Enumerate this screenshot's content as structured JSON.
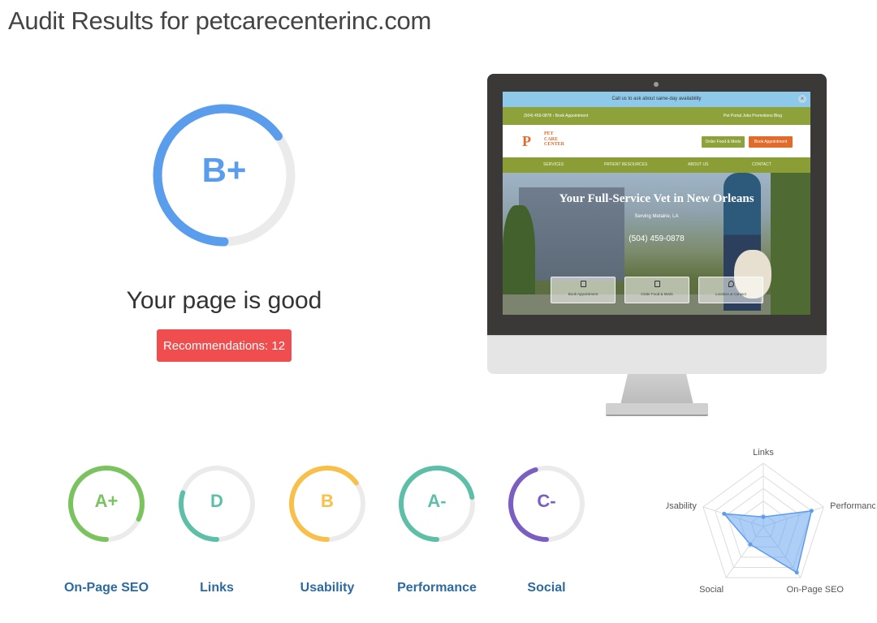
{
  "header": {
    "title": "Audit Results for petcarecenterinc.com"
  },
  "overall": {
    "grade": "B+",
    "progress": 0.65,
    "color": "#5b9ded",
    "summary": "Your page is good",
    "recommendations_label": "Recommendations: 12"
  },
  "preview": {
    "announcement": "Call us to ask about same-day availability",
    "utility_left": "(504) 459-0878   ›  Book Appointment",
    "utility_right": "Pet Portal    Jobs    Promotions    Blog",
    "logo_mark": "P",
    "logo_text": "PET\nCARE\nCENTER",
    "order_button": "Order Food & Meds",
    "book_button": "Book Appointment",
    "nav": [
      "SERVICES",
      "PATIENT RESOURCES",
      "ABOUT US",
      "CONTACT"
    ],
    "hero_title": "Your Full-Service Vet in New Orleans",
    "hero_sub": "Serving Metairie, LA",
    "hero_phone": "(504) 459-0878",
    "cards": [
      "Book Appointment",
      "Order Food & Meds",
      "Location & Contact"
    ]
  },
  "categories": [
    {
      "name": "On-Page SEO",
      "grade": "A+",
      "progress": 0.82,
      "color": "#7ac35e"
    },
    {
      "name": "Links",
      "grade": "D",
      "progress": 0.3,
      "color": "#5dbfa8"
    },
    {
      "name": "Usability",
      "grade": "B",
      "progress": 0.65,
      "color": "#f8c04a"
    },
    {
      "name": "Performance",
      "grade": "A-",
      "progress": 0.72,
      "color": "#5dbfa8"
    },
    {
      "name": "Social",
      "grade": "C-",
      "progress": 0.45,
      "color": "#7b5ec2"
    }
  ],
  "chart_data": {
    "type": "radar",
    "axes": [
      "Links",
      "Performance",
      "On-Page SEO",
      "Social",
      "Usability"
    ],
    "values": [
      0.15,
      0.8,
      0.9,
      0.35,
      0.65
    ],
    "range": [
      0,
      1
    ],
    "levels": 5,
    "color": "#5b9ded"
  }
}
